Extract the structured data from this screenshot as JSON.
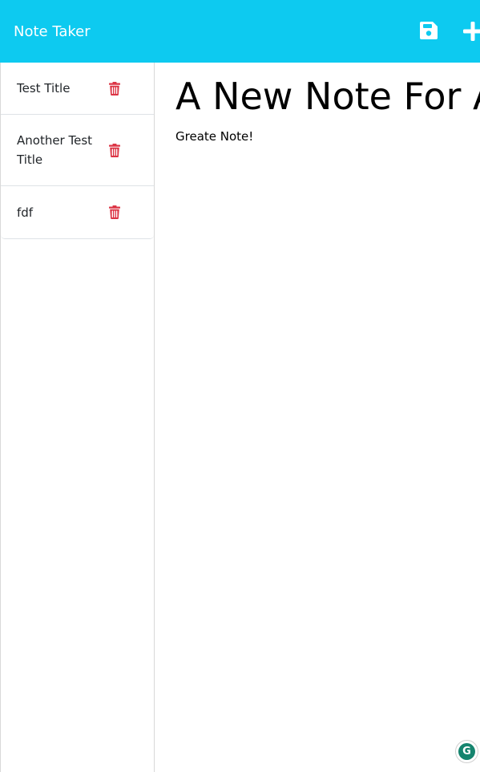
{
  "navbar": {
    "brand": "Note Taker",
    "background_color": "#0dcaf0",
    "save_icon": "floppy-disk-icon",
    "new_icon": "plus-icon"
  },
  "sidebar": {
    "notes": [
      {
        "title": "Test Title",
        "delete_icon": "trash-icon"
      },
      {
        "title": "Another Test Title",
        "delete_icon": "trash-icon"
      },
      {
        "title": "fdf",
        "delete_icon": "trash-icon"
      }
    ],
    "delete_color": "#dc3545"
  },
  "main": {
    "note_title": "A New Note For A",
    "note_text": "Greate Note!"
  },
  "widget": {
    "grammarly_letter": "G",
    "grammarly_color": "#15846e"
  }
}
